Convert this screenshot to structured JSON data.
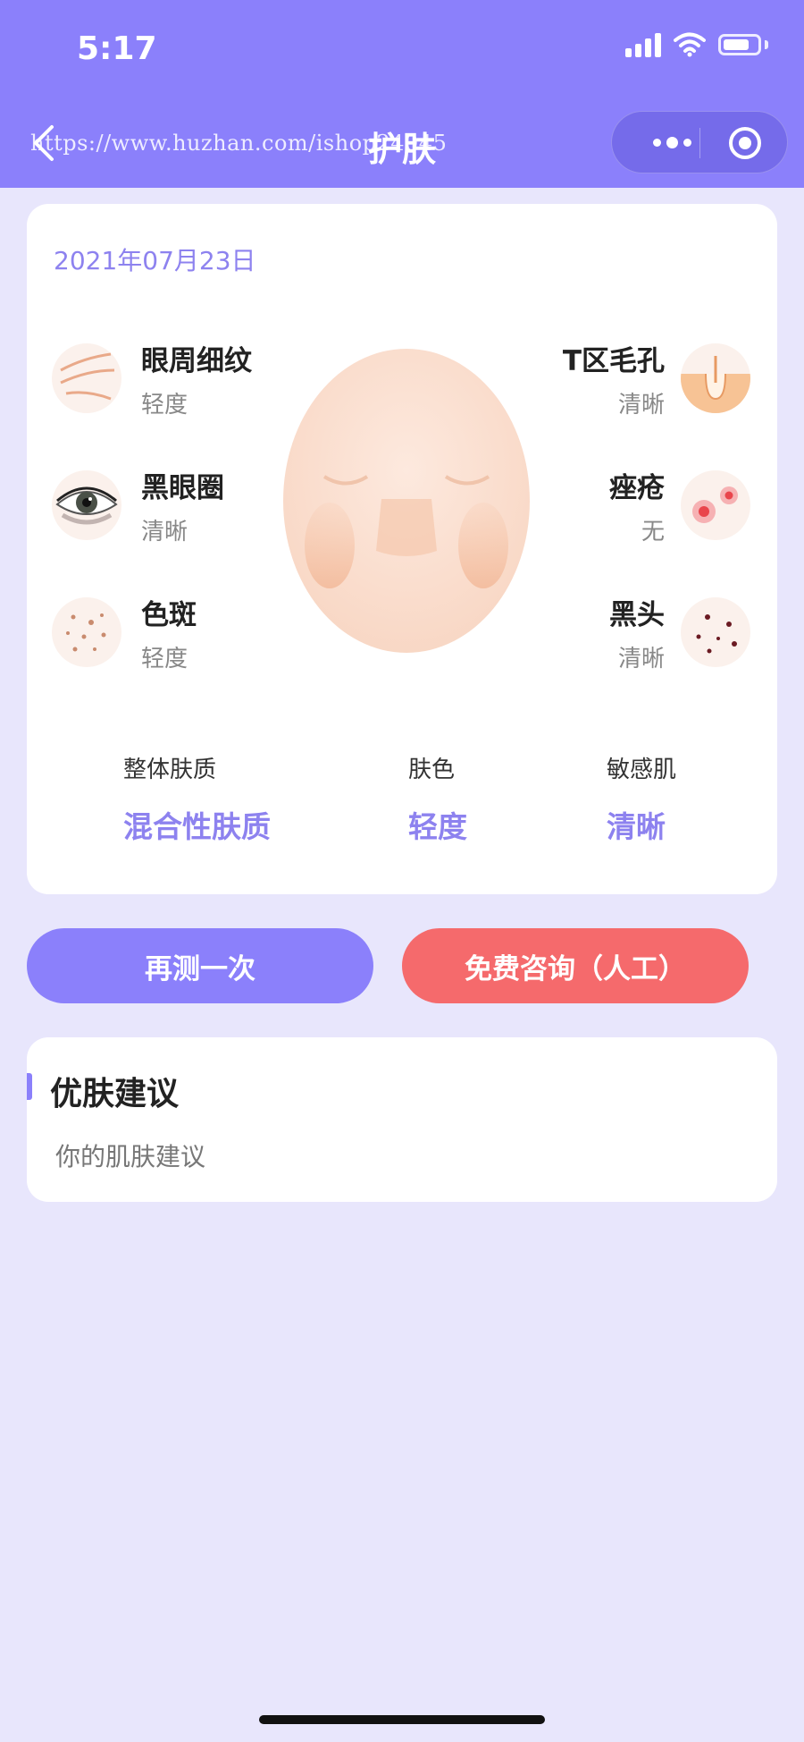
{
  "status_bar": {
    "time": "5:17"
  },
  "nav": {
    "title": "护肤",
    "watermark": "https://www.huzhan.com/ishop24045"
  },
  "report": {
    "date": "2021年07月23日",
    "features_left": [
      {
        "name": "眼周细纹",
        "value": "轻度",
        "icon": "eye-wrinkles-icon"
      },
      {
        "name": "黑眼圈",
        "value": "清晰",
        "icon": "dark-circle-icon"
      },
      {
        "name": "色斑",
        "value": "轻度",
        "icon": "spots-icon"
      }
    ],
    "features_right": [
      {
        "name": "T区毛孔",
        "value": "清晰",
        "icon": "pore-icon"
      },
      {
        "name": "痤疮",
        "value": "无",
        "icon": "acne-icon"
      },
      {
        "name": "黑头",
        "value": "清晰",
        "icon": "blackhead-icon"
      }
    ],
    "summary": [
      {
        "label": "整体肤质",
        "value": "混合性肤质"
      },
      {
        "label": "肤色",
        "value": "轻度"
      },
      {
        "label": "敏感肌",
        "value": "清晰"
      }
    ]
  },
  "actions": {
    "retest_label": "再测一次",
    "consult_label": "免费咨询（人工）"
  },
  "advice": {
    "title": "优肤建议",
    "text": "你的肌肤建议"
  },
  "colors": {
    "header": "#8b80fb",
    "background": "#e8e6fc",
    "accent": "#8d82ef",
    "consult_button": "#f56a6c"
  }
}
